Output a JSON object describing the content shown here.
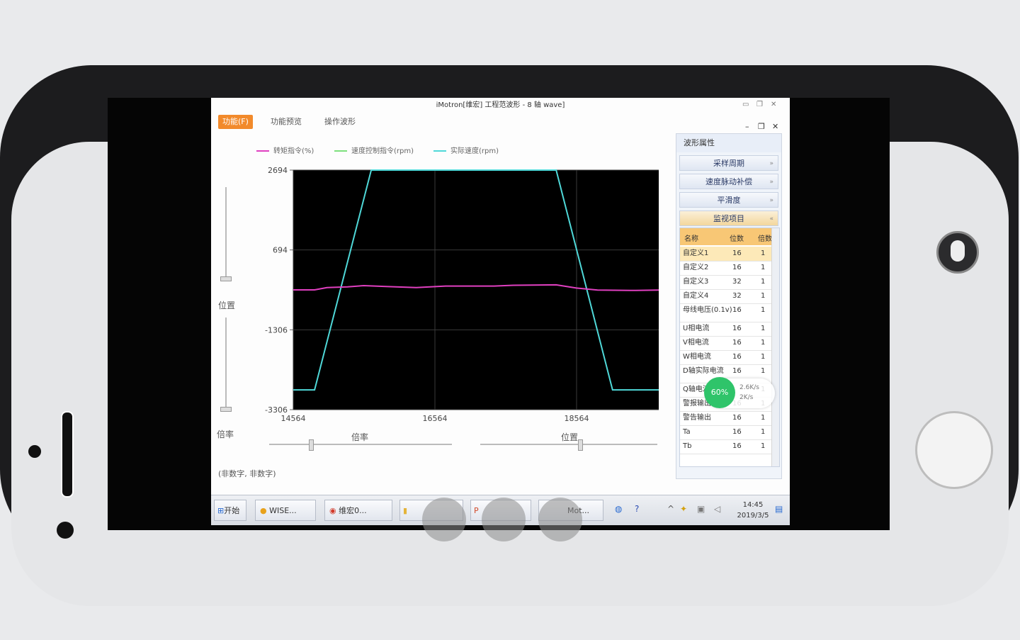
{
  "window": {
    "title": "iMotron[维宏] 工程范波形 - 8 轴 wave]",
    "tabs": [
      "功能(F)",
      "功能预览",
      "操作波形"
    ]
  },
  "legend": [
    {
      "label": "转矩指令(%)",
      "color": "#e040c0"
    },
    {
      "label": "速度控制指令(rpm)",
      "color": "#7ce07c"
    },
    {
      "label": "实际速度(rpm)",
      "color": "#4fd8d8"
    }
  ],
  "chart_data": {
    "type": "line",
    "background": "#000000",
    "y_ticks": [
      "2694",
      "694",
      "-1306",
      "-3306"
    ],
    "x_ticks": [
      "14564",
      "16564",
      "18564"
    ],
    "ylim": [
      -3306,
      2694
    ],
    "xlim": [
      14564,
      19724
    ],
    "grid": true,
    "series": [
      {
        "name": "实际速度(rpm)",
        "color": "#4fd8d8",
        "x": [
          14564,
          14865,
          15665,
          16034,
          16715,
          17474,
          18276,
          19072,
          19220,
          19724
        ],
        "y": [
          -2810,
          -2810,
          2694,
          2694,
          2694,
          2694,
          2694,
          -2810,
          -2810,
          -2810
        ]
      },
      {
        "name": "转矩指令(%)",
        "color": "#e040c0",
        "x": [
          14564,
          14865,
          15040,
          15330,
          15560,
          15875,
          16300,
          16715,
          17400,
          17670,
          18276,
          18560,
          18860,
          19400,
          19724
        ],
        "y": [
          -306,
          -306,
          -250,
          -230,
          -200,
          -220,
          -250,
          -210,
          -210,
          -190,
          -180,
          -260,
          -310,
          -320,
          -310
        ]
      }
    ]
  },
  "sliders": {
    "left_label_position": "位置",
    "left_label_rate": "倍率",
    "bottom_label_rate": "倍率",
    "bottom_label_position": "位置",
    "status": "(非数字, 非数字)"
  },
  "panel": {
    "title": "波形属性",
    "sections": [
      "采样周期",
      "速度脉动补偿",
      "平滑度",
      "监视项目"
    ],
    "table_headers": [
      "名称",
      "位数",
      "倍数"
    ],
    "rows": [
      {
        "name": "自定义1",
        "bits": "16",
        "mult": "1"
      },
      {
        "name": "自定义2",
        "bits": "16",
        "mult": "1"
      },
      {
        "name": "自定义3",
        "bits": "32",
        "mult": "1"
      },
      {
        "name": "自定义4",
        "bits": "32",
        "mult": "1"
      },
      {
        "name": "母线电压(0.1v)",
        "bits": "16",
        "mult": "1"
      },
      {
        "name": "U相电流",
        "bits": "16",
        "mult": "1"
      },
      {
        "name": "V相电流",
        "bits": "16",
        "mult": "1"
      },
      {
        "name": "W相电流",
        "bits": "16",
        "mult": "1"
      },
      {
        "name": "D轴实际电流",
        "bits": "16",
        "mult": "1"
      },
      {
        "name": "Q轴电流",
        "bits": "",
        "mult": "1"
      },
      {
        "name": "警报输出",
        "bits": "16",
        "mult": "1"
      },
      {
        "name": "警告输出",
        "bits": "16",
        "mult": "1"
      },
      {
        "name": "Ta",
        "bits": "16",
        "mult": "1"
      },
      {
        "name": "Tb",
        "bits": "16",
        "mult": "1"
      }
    ]
  },
  "taskbar": {
    "start": "开始",
    "items": [
      "WISE...",
      "维宏0...",
      "Mot..."
    ],
    "time": "14:45",
    "date": "2019/3/5"
  },
  "net_bubble": {
    "percent": "60%",
    "up": "2.6K/s",
    "down": "2K/s"
  }
}
